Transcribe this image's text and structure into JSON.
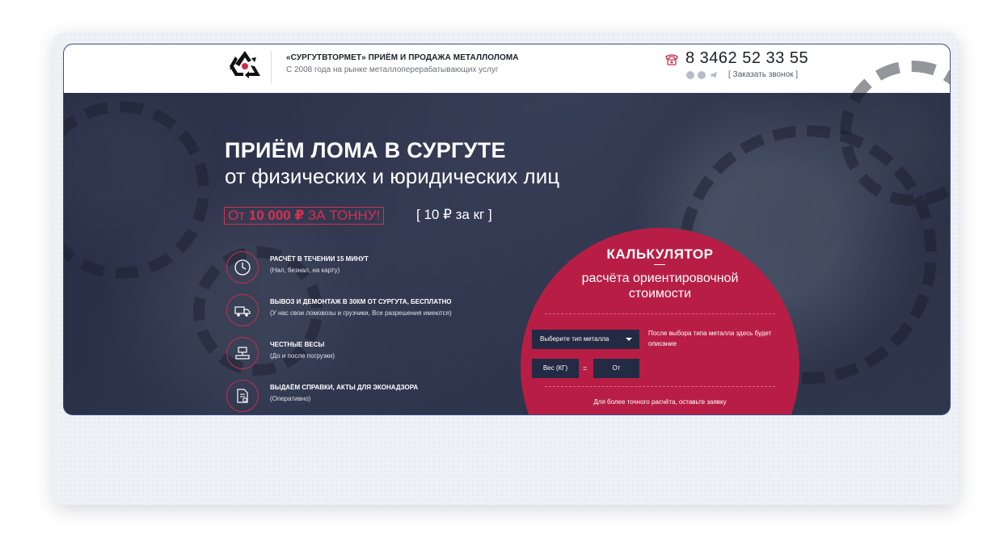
{
  "header": {
    "brand": "«СУРГУТВТОРМЕТ» ПРИЁМ И ПРОДАЖА МЕТАЛЛОЛОМА",
    "tagline": "С 2008 года на рынке металлоперерабатывающих услуг",
    "phone": "8 3462 52 33 55",
    "callback_label": "[ Заказать звонок ]",
    "social_icons": [
      "viber-icon",
      "whatsapp-icon",
      "telegram-icon"
    ]
  },
  "hero": {
    "title": "ПРИЁМ ЛОМА В СУРГУТЕ",
    "subtitle": "от физических и юридических лиц",
    "price_prefix": "От ",
    "price_value": "10 000 ₽",
    "price_suffix": " ЗА ТОННУ!",
    "price_per_kg": "[ 10 ₽ за кг ]"
  },
  "features": [
    {
      "icon": "clock-icon",
      "title": "РАСЧЁТ В ТЕЧЕНИИ 15 МИНУТ",
      "desc": "(Нал, безнал, на карту)"
    },
    {
      "icon": "truck-icon",
      "title": "ВЫВОЗ И ДЕМОНТАЖ В 30КМ ОТ СУРГУТА, БЕСПЛАТНО",
      "desc": "(У нас свои ломовозы и грузчики, Все разрешения имеются)"
    },
    {
      "icon": "scales-icon",
      "title": "ЧЕСТНЫЕ ВЕСЫ",
      "desc": "(До и после погрузки)"
    },
    {
      "icon": "document-icon",
      "title": "ВЫДАЁМ СПРАВКИ, АКТЫ ДЛЯ ЭКОНАДЗОРА",
      "desc": "(Оперативно)"
    }
  ],
  "calculator": {
    "title": "КАЛЬКУЛЯТОР",
    "subtitle_line1": "расчёта ориентировочной",
    "subtitle_line2": "стоимости",
    "select_placeholder": "Выберите тип металла",
    "hint": "После выбора типа металла здесь будет описание",
    "weight_label": "Вес (КГ)",
    "equals": "=",
    "result_label": "От",
    "footer": "Для более точного расчёта, оставьте заявку"
  },
  "colors": {
    "accent": "#b81e45",
    "accent_text": "#d8304f",
    "dark_field": "#232a43",
    "hero_bg": "#343b55"
  }
}
